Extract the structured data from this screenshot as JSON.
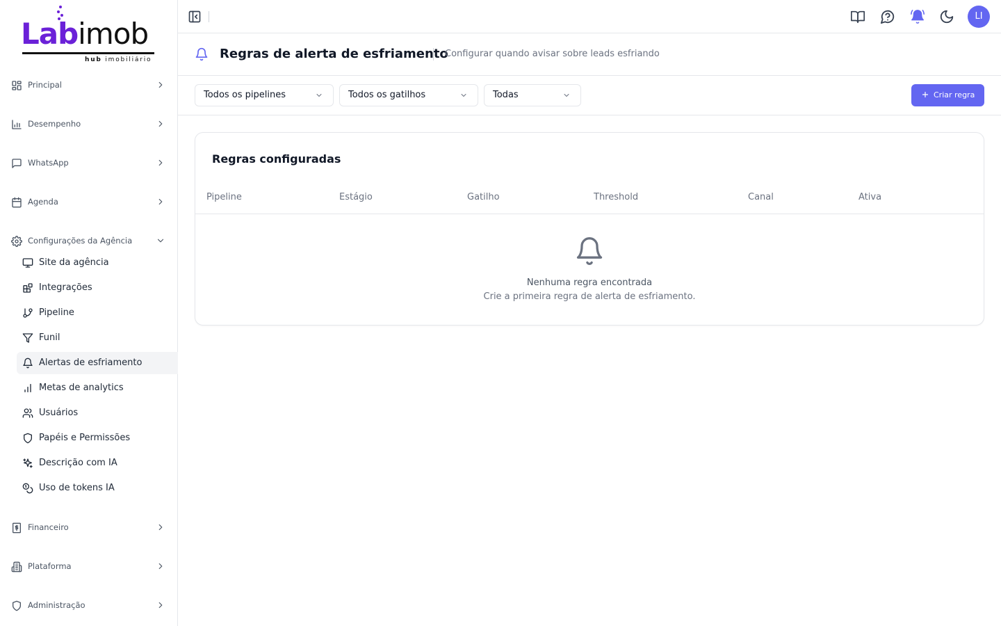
{
  "brand": {
    "logo_lab": "Lab",
    "logo_imob": "imob",
    "logo_sub_bold": "hub",
    "logo_sub_rest": "imobiliário",
    "accent_color": "#6366f1",
    "logo_color": "#6b21d8"
  },
  "sidebar": {
    "groups": [
      {
        "label": "Principal",
        "icon": "layout-grid-icon"
      },
      {
        "label": "Desempenho",
        "icon": "bar-chart-icon"
      },
      {
        "label": "WhatsApp",
        "icon": "message-square-icon"
      },
      {
        "label": "Agenda",
        "icon": "calendar-icon"
      },
      {
        "label": "Configurações da Agência",
        "icon": "settings-icon"
      },
      {
        "label": "Financeiro",
        "icon": "receipt-icon"
      },
      {
        "label": "Plataforma",
        "icon": "building-icon"
      },
      {
        "label": "Administração",
        "icon": "shield-icon"
      }
    ],
    "sub_items": [
      {
        "label": "Site da agência",
        "icon": "monitor-icon"
      },
      {
        "label": "Integrações",
        "icon": "blocks-icon"
      },
      {
        "label": "Pipeline",
        "icon": "git-branch-icon"
      },
      {
        "label": "Funil",
        "icon": "filter-icon"
      },
      {
        "label": "Alertas de esfriamento",
        "icon": "bell-icon",
        "active": true
      },
      {
        "label": "Metas de analytics",
        "icon": "bar-chart-icon"
      },
      {
        "label": "Usuários",
        "icon": "users-icon"
      },
      {
        "label": "Papéis e Permissões",
        "icon": "shield-icon"
      },
      {
        "label": "Descrição com IA",
        "icon": "sparkles-icon"
      },
      {
        "label": "Uso de tokens IA",
        "icon": "coins-icon"
      }
    ]
  },
  "topbar": {
    "avatar_initials": "LI",
    "icons": [
      "book-open-icon",
      "help-circle-icon",
      "bell-ring-icon",
      "moon-icon"
    ]
  },
  "header": {
    "title": "Regras de alerta de esfriamento",
    "subtitle": "Configurar quando avisar sobre leads esfriando"
  },
  "filters": {
    "pipeline": "Todos os pipelines",
    "trigger": "Todos os gatilhos",
    "status": "Todas",
    "create_label": "Criar regra"
  },
  "rules_table": {
    "title": "Regras configuradas",
    "columns": [
      "Pipeline",
      "Estágio",
      "Gatilho",
      "Threshold",
      "Canal",
      "Ativa"
    ],
    "empty_title": "Nenhuma regra encontrada",
    "empty_subtitle": "Crie a primeira regra de alerta de esfriamento."
  }
}
